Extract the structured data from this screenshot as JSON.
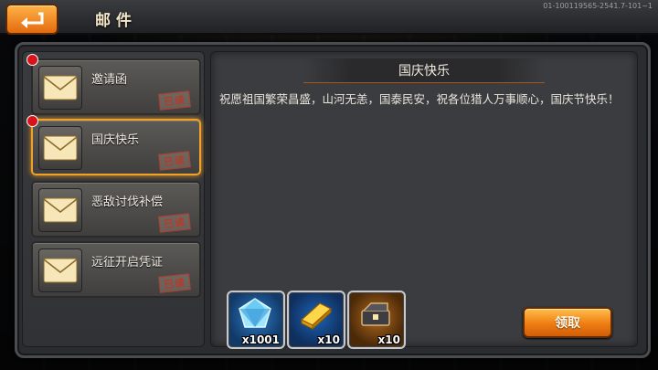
{
  "header": {
    "title": "邮件",
    "build_info": "01-100119565-2541.7-101~1"
  },
  "mails": [
    {
      "label": "邀请函",
      "status": "已读",
      "unread_dot": true,
      "selected": false
    },
    {
      "label": "国庆快乐",
      "status": "已读",
      "unread_dot": true,
      "selected": true
    },
    {
      "label": "恶敌讨伐补偿",
      "status": "已读",
      "unread_dot": false,
      "selected": false
    },
    {
      "label": "远征开启凭证",
      "status": "已读",
      "unread_dot": false,
      "selected": false
    }
  ],
  "detail": {
    "title": "国庆快乐",
    "body": "祝愿祖国繁荣昌盛，山河无恙，国泰民安，祝各位猎人万事顺心，国庆节快乐！",
    "rewards": [
      {
        "icon": "crystal-icon",
        "count": "x1001",
        "frame": "blue"
      },
      {
        "icon": "gold-bar-icon",
        "count": "x10",
        "frame": "blue"
      },
      {
        "icon": "equipment-chest-icon",
        "count": "x10",
        "frame": "bronze"
      }
    ],
    "claim_label": "领取"
  },
  "colors": {
    "accent_orange": "#ef7d12",
    "unread_red": "#d8141a",
    "stamp_red": "#b83a2a",
    "selected_border": "#f0a228"
  }
}
